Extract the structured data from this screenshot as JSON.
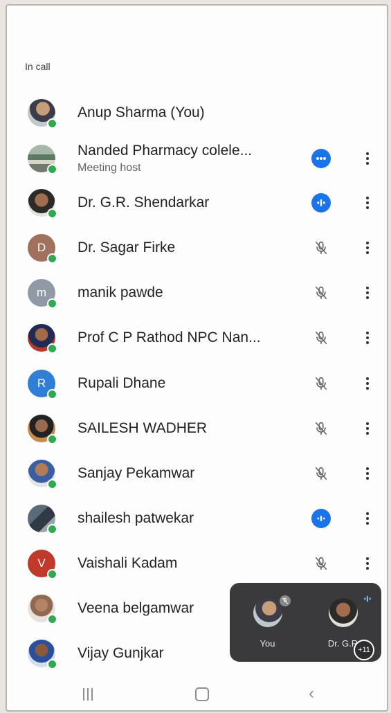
{
  "section_title": "In call",
  "participants": [
    {
      "name": "Anup Sharma (You)",
      "avatar": "photo",
      "status": "none"
    },
    {
      "name": "Nanded Pharmacy colele...",
      "subtitle": "Meeting host",
      "avatar": "photo",
      "status": "more-options-badge"
    },
    {
      "name": "Dr. G.R. Shendarkar",
      "avatar": "photo",
      "status": "speaking"
    },
    {
      "name": "Dr. Sagar Firke",
      "avatar": "letter",
      "initial": "D",
      "color": "#a0715c",
      "status": "muted"
    },
    {
      "name": "manik pawde",
      "avatar": "letter",
      "initial": "m",
      "color": "#8f9aa6",
      "status": "muted"
    },
    {
      "name": "Prof C P Rathod NPC Nan...",
      "avatar": "photo",
      "status": "muted"
    },
    {
      "name": "Rupali Dhane",
      "avatar": "letter",
      "initial": "R",
      "color": "#2f7fd7",
      "status": "muted"
    },
    {
      "name": "SAILESH WADHER",
      "avatar": "photo",
      "status": "muted"
    },
    {
      "name": "Sanjay Pekamwar",
      "avatar": "photo",
      "status": "muted"
    },
    {
      "name": "shailesh patwekar",
      "avatar": "photo",
      "status": "speaking"
    },
    {
      "name": "Vaishali Kadam",
      "avatar": "letter",
      "initial": "V",
      "color": "#c0392b",
      "status": "muted"
    },
    {
      "name": "Veena belgamwar",
      "avatar": "photo",
      "status": "none"
    },
    {
      "name": "Vijay Gunjkar",
      "avatar": "photo",
      "status": "none"
    }
  ],
  "pip": {
    "tile_1_label": "You",
    "tile_2_label": "Dr. G.R",
    "extra_count": "+11"
  },
  "colors": {
    "accent": "#1a73e8",
    "online_dot": "#33a852",
    "pip_background": "#3a3a3c"
  },
  "icons": {
    "status_muted": "mic-off-icon",
    "status_speaking": "audio-levels-icon",
    "status_more": "more-horiz-icon",
    "row_menu": "more-vert-icon"
  }
}
